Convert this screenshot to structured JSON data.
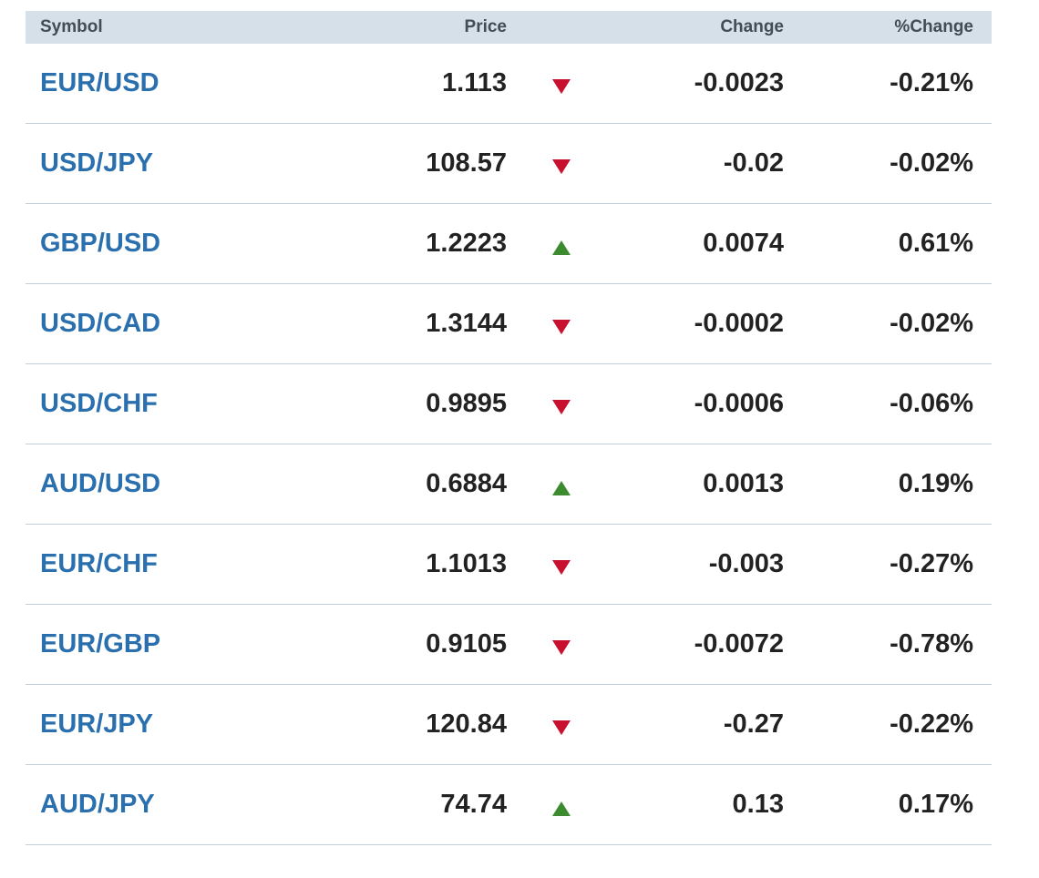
{
  "header": {
    "symbol": "Symbol",
    "price": "Price",
    "change": "Change",
    "pct_change": "%Change"
  },
  "colors": {
    "symbol_link": "#2a6fae",
    "down_arrow": "#c8102e",
    "up_arrow": "#3d8b2f",
    "header_bg": "#d5e0e8"
  },
  "rows": [
    {
      "symbol": "EUR/USD",
      "price": "1.113",
      "direction": "down",
      "change": "-0.0023",
      "pct": "-0.21%"
    },
    {
      "symbol": "USD/JPY",
      "price": "108.57",
      "direction": "down",
      "change": "-0.02",
      "pct": "-0.02%"
    },
    {
      "symbol": "GBP/USD",
      "price": "1.2223",
      "direction": "up",
      "change": "0.0074",
      "pct": "0.61%"
    },
    {
      "symbol": "USD/CAD",
      "price": "1.3144",
      "direction": "down",
      "change": "-0.0002",
      "pct": "-0.02%"
    },
    {
      "symbol": "USD/CHF",
      "price": "0.9895",
      "direction": "down",
      "change": "-0.0006",
      "pct": "-0.06%"
    },
    {
      "symbol": "AUD/USD",
      "price": "0.6884",
      "direction": "up",
      "change": "0.0013",
      "pct": "0.19%"
    },
    {
      "symbol": "EUR/CHF",
      "price": "1.1013",
      "direction": "down",
      "change": "-0.003",
      "pct": "-0.27%"
    },
    {
      "symbol": "EUR/GBP",
      "price": "0.9105",
      "direction": "down",
      "change": "-0.0072",
      "pct": "-0.78%"
    },
    {
      "symbol": "EUR/JPY",
      "price": "120.84",
      "direction": "down",
      "change": "-0.27",
      "pct": "-0.22%"
    },
    {
      "symbol": "AUD/JPY",
      "price": "74.74",
      "direction": "up",
      "change": "0.13",
      "pct": "0.17%"
    }
  ]
}
